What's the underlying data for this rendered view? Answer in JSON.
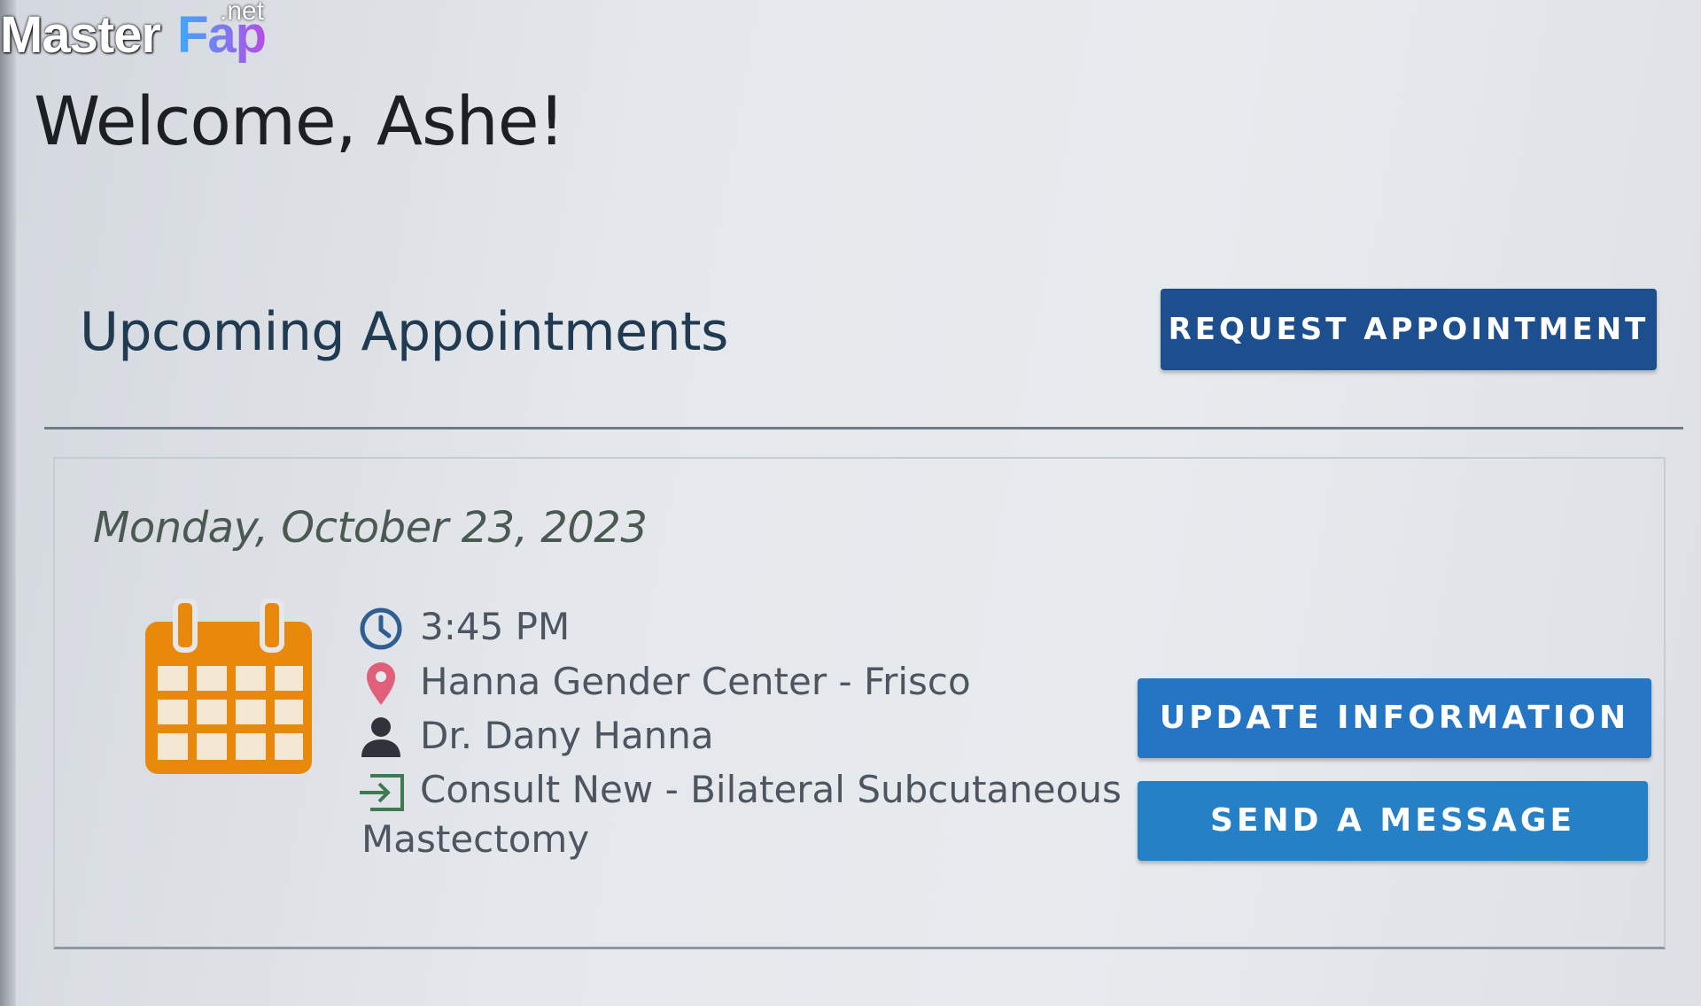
{
  "watermark": {
    "part1": "Master",
    "part2": "Fap",
    "part3": ".net"
  },
  "header": {
    "welcome": "Welcome, Ashe!"
  },
  "upcoming": {
    "title": "Upcoming Appointments",
    "request_button": "REQUEST APPOINTMENT"
  },
  "appointment": {
    "date": "Monday, October 23, 2023",
    "time": "3:45 PM",
    "location": "Hanna Gender Center - Frisco",
    "provider": "Dr. Dany Hanna",
    "type_line1": "Consult New - Bilateral Subcutaneous",
    "type_line2": "Mastectomy",
    "update_button": "UPDATE INFORMATION",
    "message_button": "SEND A MESSAGE"
  },
  "colors": {
    "primary_dark": "#1d4f8f",
    "primary": "#2476c4",
    "calendar_orange": "#e8890c",
    "location_pin": "#e0607a",
    "date_text": "#4a5a52"
  },
  "icons": [
    "calendar-icon",
    "clock-icon",
    "location-pin-icon",
    "person-icon",
    "sign-in-icon"
  ]
}
